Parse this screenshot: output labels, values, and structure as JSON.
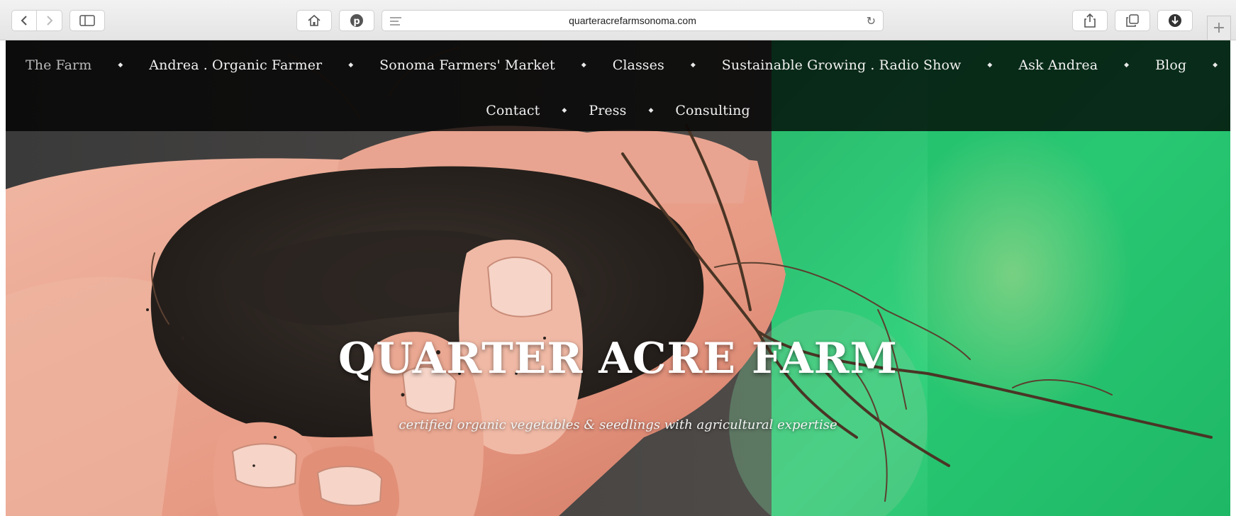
{
  "browser": {
    "url": "quarteracrefarmsonoma.com",
    "new_tab_glyph": "+",
    "icons": [
      "back-icon",
      "forward-icon",
      "sidebar-icon",
      "home-icon",
      "pinterest-icon",
      "reader-icon",
      "reload-icon",
      "share-icon",
      "tabs-icon",
      "download-icon"
    ]
  },
  "nav": {
    "row1": [
      "The Farm",
      "Andrea . Organic Farmer",
      "Sonoma Farmers' Market",
      "Classes",
      "Sustainable Growing . Radio Show",
      "Ask Andrea",
      "Blog"
    ],
    "row2": [
      "Contact",
      "Press",
      "Consulting"
    ],
    "separator": "◆",
    "current": "The Farm"
  },
  "hero": {
    "title": "QUARTER ACRE FARM",
    "tagline": "certified organic vegetables & seedlings with agricultural expertise"
  },
  "colors": {
    "nav_bg": "#000000",
    "hero_green": "#2fc97a",
    "skin": "#e9a08c",
    "soil": "#2a2420"
  }
}
